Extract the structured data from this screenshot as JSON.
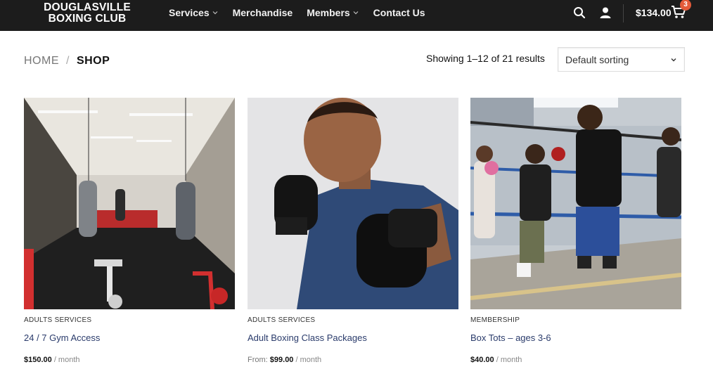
{
  "header": {
    "logo_line1": "DOUGLASVILLE",
    "logo_line2": "BOXING CLUB",
    "nav": [
      {
        "label": "Services",
        "has_dropdown": true
      },
      {
        "label": "Merchandise",
        "has_dropdown": false
      },
      {
        "label": "Members",
        "has_dropdown": true
      },
      {
        "label": "Contact Us",
        "has_dropdown": false
      }
    ],
    "cart_total": "$134.00",
    "cart_count": "3",
    "icons": [
      "search-icon",
      "user-icon",
      "cart-icon"
    ]
  },
  "breadcrumb": {
    "home": "HOME",
    "separator": "/",
    "current": "SHOP"
  },
  "toolbar": {
    "result_count": "Showing 1–12 of 21 results",
    "sort_selected": "Default sorting"
  },
  "products": [
    {
      "category": "ADULTS SERVICES",
      "title": "24 / 7 Gym Access",
      "price_prefix": "",
      "price": "$150.00",
      "period": " / month"
    },
    {
      "category": "ADULTS SERVICES",
      "title": "Adult Boxing Class Packages",
      "price_prefix": "From: ",
      "price": "$99.00",
      "period": " / month"
    },
    {
      "category": "MEMBERSHIP",
      "title": "Box Tots – ages 3-6",
      "price_prefix": "",
      "price": "$40.00",
      "period": " / month"
    }
  ],
  "colors": {
    "header_bg": "#1c1c1c",
    "badge": "#e35b3a",
    "product_title": "#2a3b6b"
  }
}
